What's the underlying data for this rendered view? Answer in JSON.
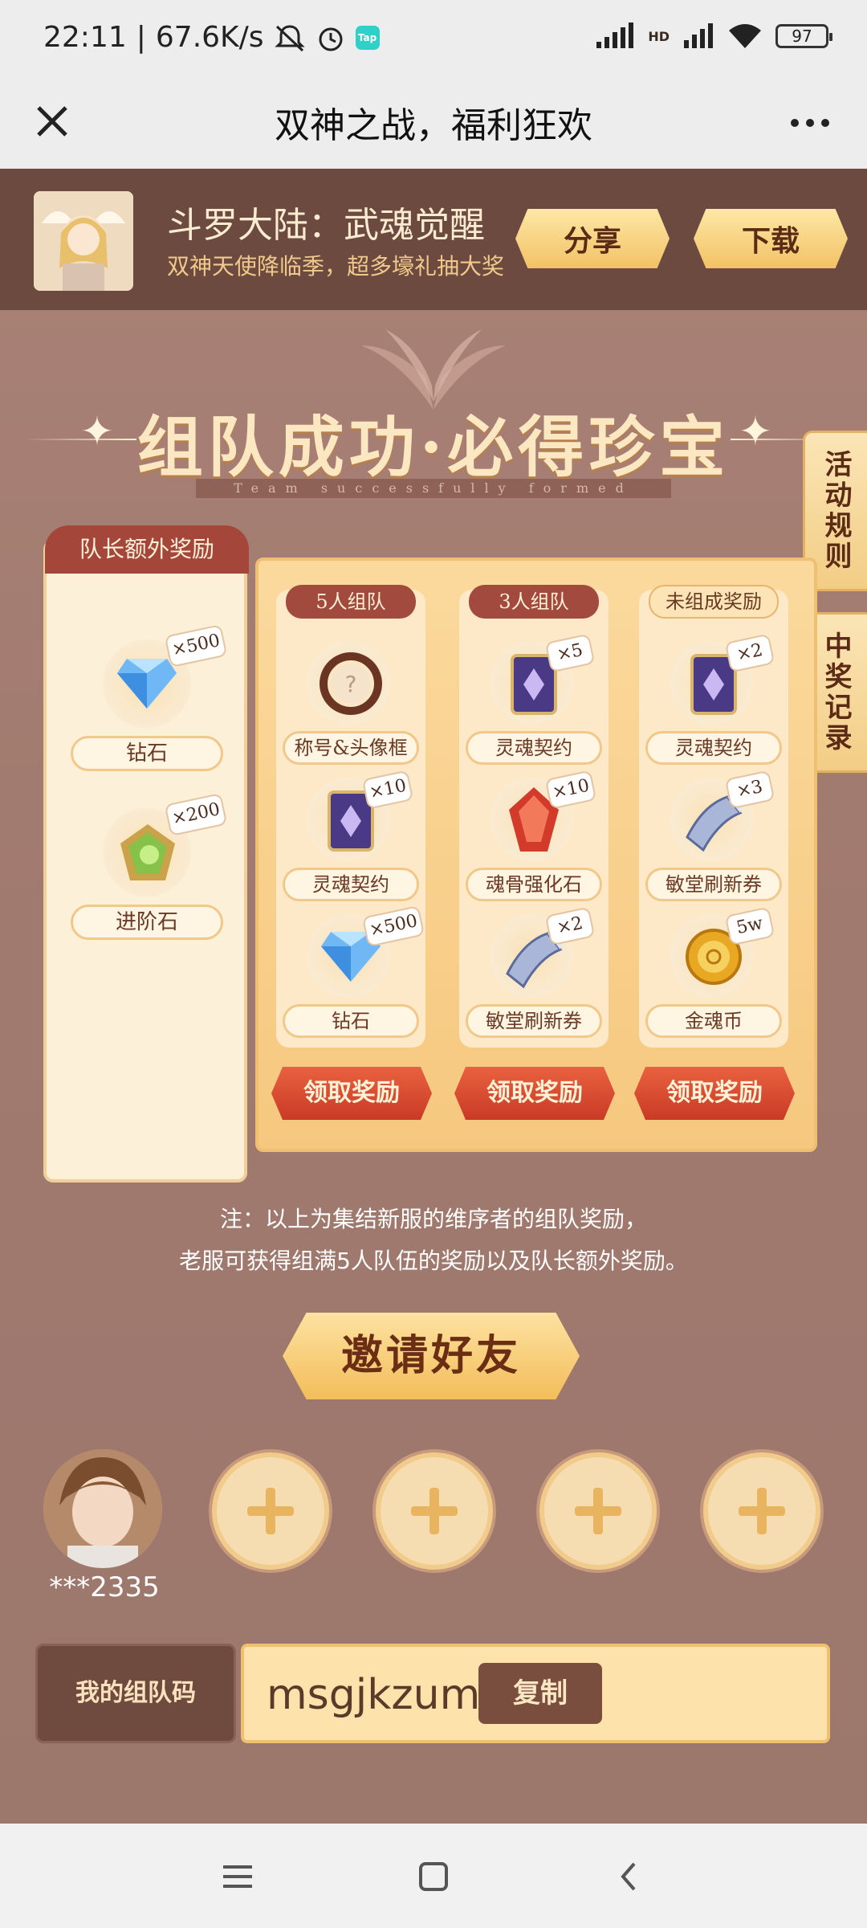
{
  "status_bar": {
    "time": "22:11",
    "speed": "67.6K/s",
    "tap_badge": "Tap",
    "network": "HD",
    "battery": "97"
  },
  "nav": {
    "title": "双神之战，福利狂欢"
  },
  "game": {
    "name": "斗罗大陆：武魂觉醒",
    "slogan": "双神天使降临季，超多壕礼抽大奖",
    "share_label": "分享",
    "download_label": "下载"
  },
  "banner": {
    "title": "组队成功·必得珍宝",
    "subtitle": "Team successfully formed"
  },
  "side_tabs": {
    "rules": "活动规则",
    "records": "中奖记录"
  },
  "captain": {
    "title": "队长额外奖励",
    "items": [
      {
        "name": "钻石",
        "qty": "×500",
        "icon": "diamond-icon"
      },
      {
        "name": "进阶石",
        "qty": "×200",
        "icon": "advance-stone-icon"
      }
    ]
  },
  "columns": [
    {
      "title": "5人组队",
      "rewards": [
        {
          "name": "称号&头像框",
          "qty": "",
          "icon": "avatar-frame-icon"
        },
        {
          "name": "灵魂契约",
          "qty": "×10",
          "icon": "soul-contract-icon"
        },
        {
          "name": "钻石",
          "qty": "×500",
          "icon": "diamond-icon"
        }
      ],
      "claim_label": "领取奖励"
    },
    {
      "title": "3人组队",
      "rewards": [
        {
          "name": "灵魂契约",
          "qty": "×5",
          "icon": "soul-contract-icon"
        },
        {
          "name": "魂骨强化石",
          "qty": "×10",
          "icon": "bone-stone-icon"
        },
        {
          "name": "敏堂刷新券",
          "qty": "×2",
          "icon": "refresh-ticket-icon"
        }
      ],
      "claim_label": "领取奖励"
    },
    {
      "title": "未组成奖励",
      "rewards": [
        {
          "name": "灵魂契约",
          "qty": "×2",
          "icon": "soul-contract-icon"
        },
        {
          "name": "敏堂刷新券",
          "qty": "×3",
          "icon": "refresh-ticket-icon"
        },
        {
          "name": "金魂币",
          "qty": "5w",
          "icon": "gold-coin-icon"
        }
      ],
      "claim_label": "领取奖励"
    }
  ],
  "note": {
    "line1": "注：以上为集结新服的维序者的组队奖励，",
    "line2": "老服可获得组满5人队伍的奖励以及队长额外奖励。"
  },
  "invite": {
    "label": "邀请好友"
  },
  "team": {
    "leader_name": "***2335",
    "empty_slots": 4
  },
  "team_code": {
    "label": "我的组队码",
    "value": "msgjkzum",
    "copy_label": "复制"
  },
  "colors": {
    "page_bg": "#a17a6f",
    "header_bg": "#6c4a40",
    "accent_red": "#c93a26",
    "accent_gold": "#f3bd5a"
  }
}
